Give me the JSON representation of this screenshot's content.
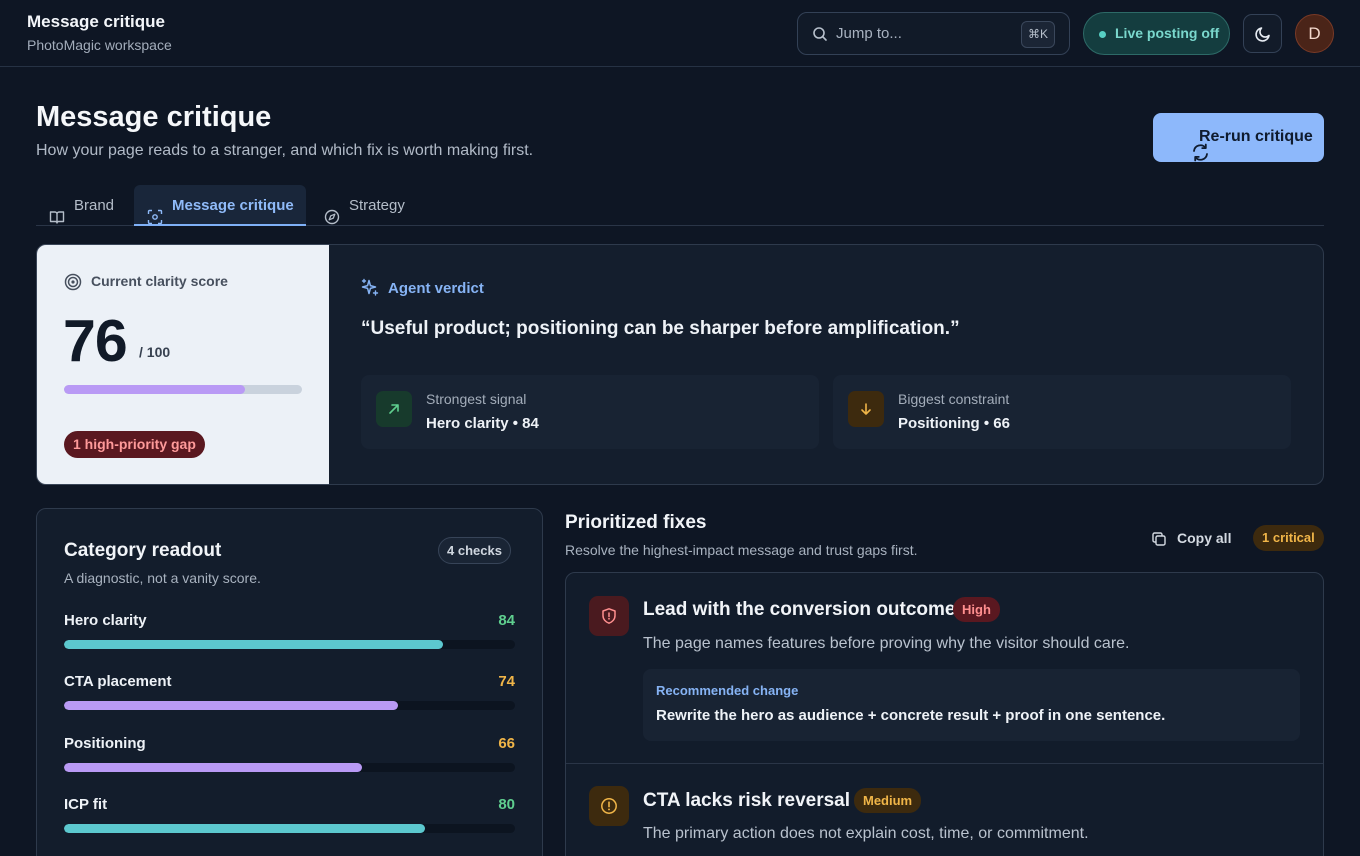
{
  "workspace": {
    "title": "Message critique",
    "subtitle": "PhotoMagic workspace"
  },
  "topbar": {
    "jump_placeholder": "Jump to...",
    "jump_shortcut": "⌘K",
    "live_label": "Live posting off",
    "avatar_initial": "D",
    "icons": {
      "search": "search-icon",
      "theme": "moon-icon"
    }
  },
  "header": {
    "title": "Message critique",
    "subtitle": "How your page reads to a stranger, and which fix is worth making first.",
    "rerun_label": "Re-run critique"
  },
  "tabs": [
    {
      "label": "Brand",
      "icon": "book-icon",
      "active": false
    },
    {
      "label": "Message critique",
      "icon": "scan-icon",
      "active": true
    },
    {
      "label": "Strategy",
      "icon": "compass-icon",
      "active": false
    }
  ],
  "score": {
    "header": "Current clarity score",
    "value": "76",
    "denominator": "/ 100",
    "progress": 0.76,
    "gap_badge": "1 high-priority gap"
  },
  "verdict": {
    "label": "Agent verdict",
    "quote": "“Useful product; positioning can be sharper before amplification.”",
    "strongest": {
      "label": "Strongest signal",
      "value": "Hero clarity • 84"
    },
    "constraint": {
      "label": "Biggest constraint",
      "value": "Positioning • 66"
    }
  },
  "category": {
    "title": "Category readout",
    "subtitle": "A diagnostic, not a vanity score.",
    "checks_badge": "4 checks",
    "metrics": [
      {
        "name": "Hero clarity",
        "value": "84",
        "score": 84,
        "color": "#5cc8cf",
        "value_color": "#5fcf8f"
      },
      {
        "name": "CTA placement",
        "value": "74",
        "score": 74,
        "color": "#b99af5",
        "value_color": "#f0b548"
      },
      {
        "name": "Positioning",
        "value": "66",
        "score": 66,
        "color": "#b99af5",
        "value_color": "#f0b548"
      },
      {
        "name": "ICP fit",
        "value": "80",
        "score": 80,
        "color": "#5cc8cf",
        "value_color": "#5fcf8f"
      }
    ]
  },
  "fixes": {
    "title": "Prioritized fixes",
    "subtitle": "Resolve the highest-impact message and trust gaps first.",
    "copy_all": "Copy all",
    "critical_badge": "1 critical",
    "items": [
      {
        "title": "Lead with the conversion outcome",
        "priority": "High",
        "description": "The page names features before proving why the visitor should care.",
        "recommended_label": "Recommended change",
        "recommended_text": "Rewrite the hero as audience + concrete result + proof in one sentence."
      },
      {
        "title": "CTA lacks risk reversal",
        "priority": "Medium",
        "description": "The primary action does not explain cost, time, or commitment."
      }
    ]
  },
  "colors": {
    "accent": "#8db8fb",
    "high": "#ff9a9a",
    "medium": "#f0b548",
    "good": "#5fcf8f"
  }
}
